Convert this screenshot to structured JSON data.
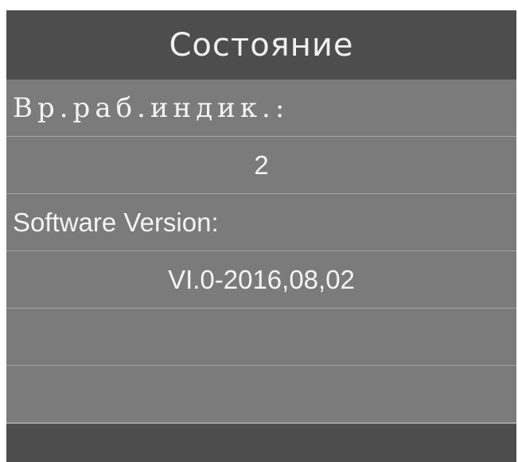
{
  "header": {
    "title": "Состояние"
  },
  "rows": [
    {
      "text": "Вр.раб.индик.:"
    },
    {
      "text": "2"
    },
    {
      "text": "Software Version:"
    },
    {
      "text": "VI.0-2016,08,02"
    },
    {
      "text": ""
    },
    {
      "text": ""
    }
  ]
}
